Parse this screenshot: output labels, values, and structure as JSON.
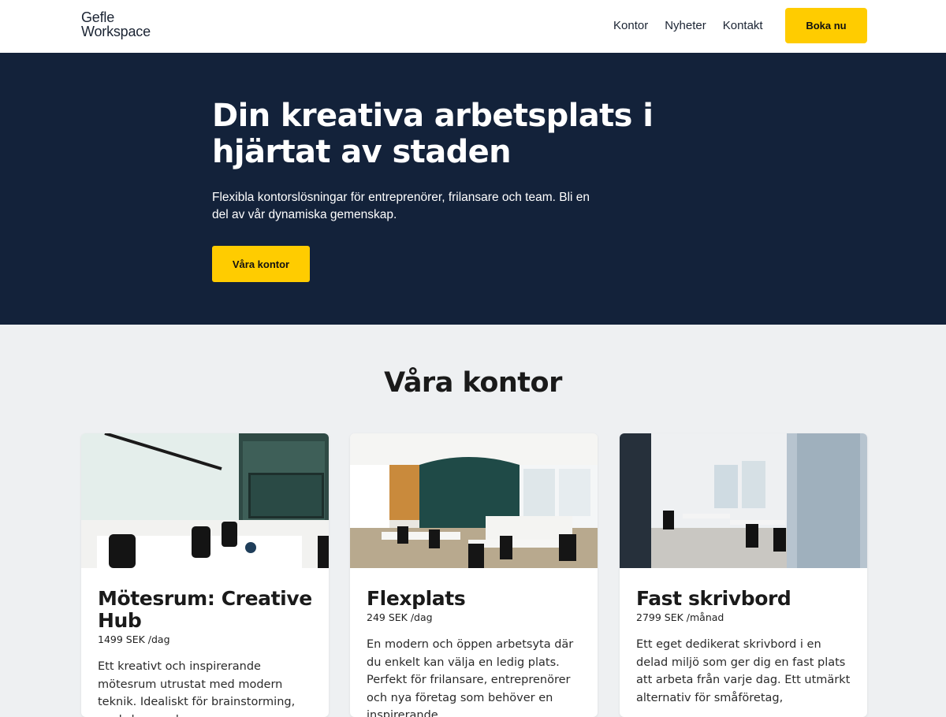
{
  "header": {
    "logo_line1": "Gefle",
    "logo_line2": "Workspace",
    "nav": [
      "Kontor",
      "Nyheter",
      "Kontakt"
    ],
    "cta_label": "Boka nu"
  },
  "hero": {
    "title": "Din kreativa arbetsplats i hjärtat av staden",
    "subtitle": "Flexibla kontorslösningar för entreprenörer, frilansare och team. Bli en del av vår dynamiska gemenskap.",
    "button_label": "Våra kontor"
  },
  "offices": {
    "title": "Våra kontor",
    "cards": [
      {
        "title": "Mötesrum: Creative Hub",
        "price": "1499 SEK /dag",
        "description": "Ett kreativt och inspirerande mötesrum utrustat med modern teknik. Idealiskt för brainstorming, workshops och"
      },
      {
        "title": "Flexplats",
        "price": "249 SEK /dag",
        "description": "En modern och öppen arbetsyta där du enkelt kan välja en ledig plats. Perfekt för frilansare, entreprenörer och nya företag som behöver en inspirerande"
      },
      {
        "title": "Fast skrivbord",
        "price": "2799 SEK /månad",
        "description": "Ett eget dedikerat skrivbord i en delad miljö som ger dig en fast plats att arbeta från varje dag. Ett utmärkt alternativ för småföretag,"
      }
    ]
  },
  "colors": {
    "header_bg": "#ffffff",
    "hero_bg": "#13223a",
    "accent": "#ffcc00",
    "page_bg": "#eef0f2"
  }
}
